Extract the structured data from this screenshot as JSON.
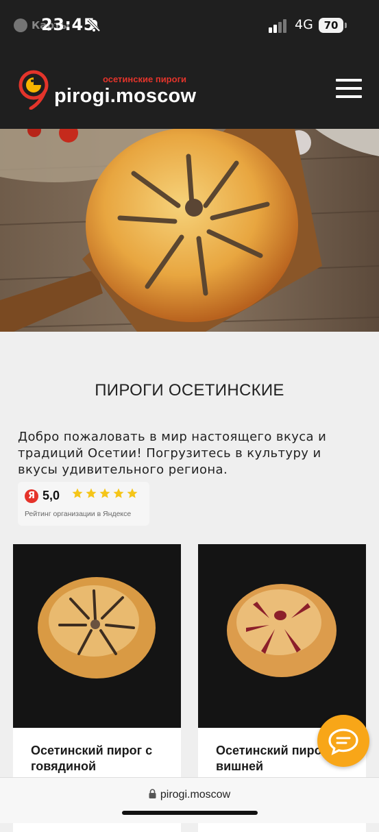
{
  "status_bar": {
    "back_app": "Карты",
    "time": "23:45",
    "network": "4G",
    "battery": "70"
  },
  "header": {
    "tagline": "осетинские пироги",
    "brand": "pirogi.moscow",
    "accent_color": "#e3342b"
  },
  "main": {
    "title": "ПИРОГИ ОСЕТИНСКИЕ",
    "intro": "Добро пожаловать в мир настоящего вкуса и традиций Осетии! Погрузитесь в культуру и вкусы удивительного региона.",
    "rating": {
      "logo_letter": "Я",
      "score": "5,0",
      "stars": 5,
      "caption": "Рейтинг организации в Яндексе"
    },
    "products": [
      {
        "name": "Осетинский пирог с говядиной"
      },
      {
        "name": "Осетинский пирог с вишней"
      }
    ]
  },
  "browser": {
    "url": "pirogi.moscow"
  },
  "colors": {
    "header_bg": "#1f1f1f",
    "page_bg": "#efefef",
    "chat_button": "#f8a618",
    "star": "#f5c518"
  }
}
